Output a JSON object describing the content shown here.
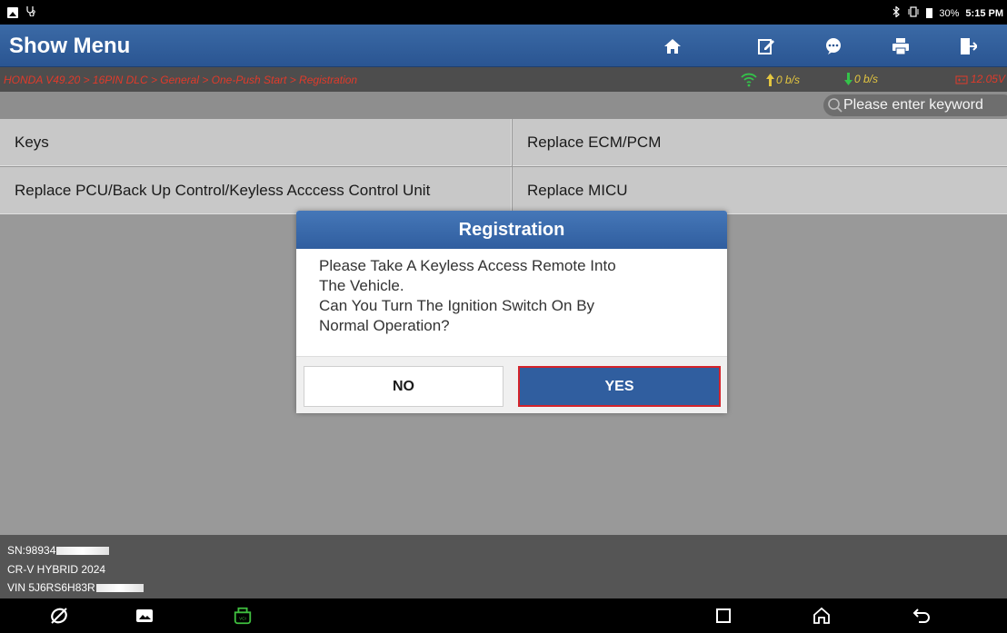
{
  "status_bar": {
    "battery": "30%",
    "time": "5:15 PM",
    "icons": [
      "gallery-icon",
      "stethoscope-icon",
      "bluetooth-icon",
      "vibrate-icon",
      "battery-icon"
    ]
  },
  "header": {
    "title": "Show Menu",
    "buttons": [
      "home-icon",
      "edit-report-icon",
      "chat-icon",
      "print-icon",
      "exit-icon"
    ]
  },
  "breadcrumb": {
    "path": "HONDA V49.20 > 16PIN DLC > General > One-Push Start > Registration",
    "upload_rate": "0 b/s",
    "download_rate": "0 b/s",
    "voltage": "12.05V"
  },
  "search": {
    "placeholder": "Please enter keyword"
  },
  "menu": {
    "items": [
      {
        "label": "Keys"
      },
      {
        "label": "Replace ECM/PCM"
      },
      {
        "label": "Replace PCU/Back Up Control/Keyless Acccess Control Unit"
      },
      {
        "label": "Replace MICU"
      }
    ]
  },
  "dialog": {
    "title": "Registration",
    "line1": "Please Take A Keyless Access Remote Into",
    "line2": "The Vehicle.",
    "line3": "Can You Turn The Ignition Switch On By",
    "line4": "Normal Operation?",
    "no_label": "NO",
    "yes_label": "YES"
  },
  "vehicle_info": {
    "sn": "SN:98934",
    "model": "CR-V HYBRID 2024",
    "vin": "VIN 5J6RS6H83R"
  },
  "colors": {
    "header_blue": "#2a5592",
    "breadcrumb_red": "#e03a2a",
    "rate_yellow": "#e4c640",
    "yes_border": "#d4232b",
    "vci_green": "#3fbf3f"
  },
  "nav_bar": {
    "icons": [
      "browser-icon",
      "gallery-icon",
      "vci-icon",
      "recents-icon",
      "home-icon",
      "back-icon"
    ]
  }
}
